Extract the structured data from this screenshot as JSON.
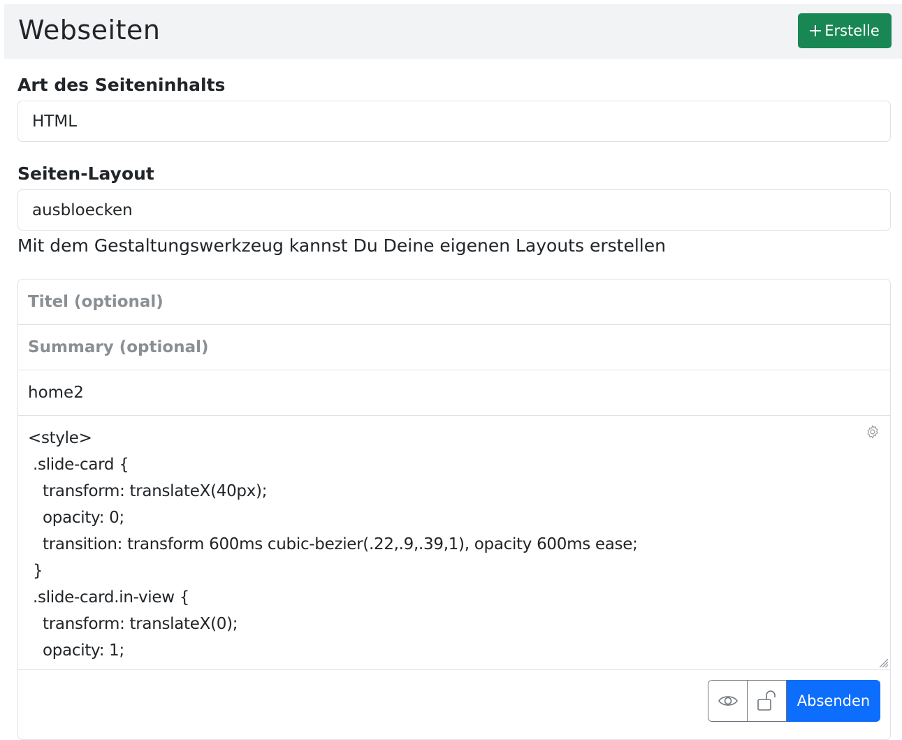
{
  "header": {
    "title": "Webseiten",
    "create_label": "Erstelle",
    "create_icon": "plus-icon"
  },
  "content_type": {
    "label": "Art des Seiteninhalts",
    "value": "HTML"
  },
  "layout": {
    "label": "Seiten-Layout",
    "value": "ausbloecken",
    "help": "Mit dem Gestaltungswerkzeug kannst Du Deine eigenen Layouts erstellen"
  },
  "form": {
    "title_placeholder": "Titel (optional)",
    "summary_placeholder": "Summary (optional)",
    "slug_value": "home2",
    "editor_lines": [
      "<style>",
      " .slide-card {",
      "   transform: translateX(40px);",
      "   opacity: 0;",
      "   transition: transform 600ms cubic-bezier(.22,.9,.39,1), opacity 600ms ease;",
      " }",
      " .slide-card.in-view {",
      "   transform: translateX(0);",
      "   opacity: 1;"
    ],
    "toolbar": {
      "preview_icon": "eye-icon",
      "lock_icon": "unlock-icon",
      "submit_label": "Absenden"
    }
  },
  "colors": {
    "create_button": "#198754",
    "submit_button": "#0d6efd",
    "header_background": "#f2f3f4"
  }
}
